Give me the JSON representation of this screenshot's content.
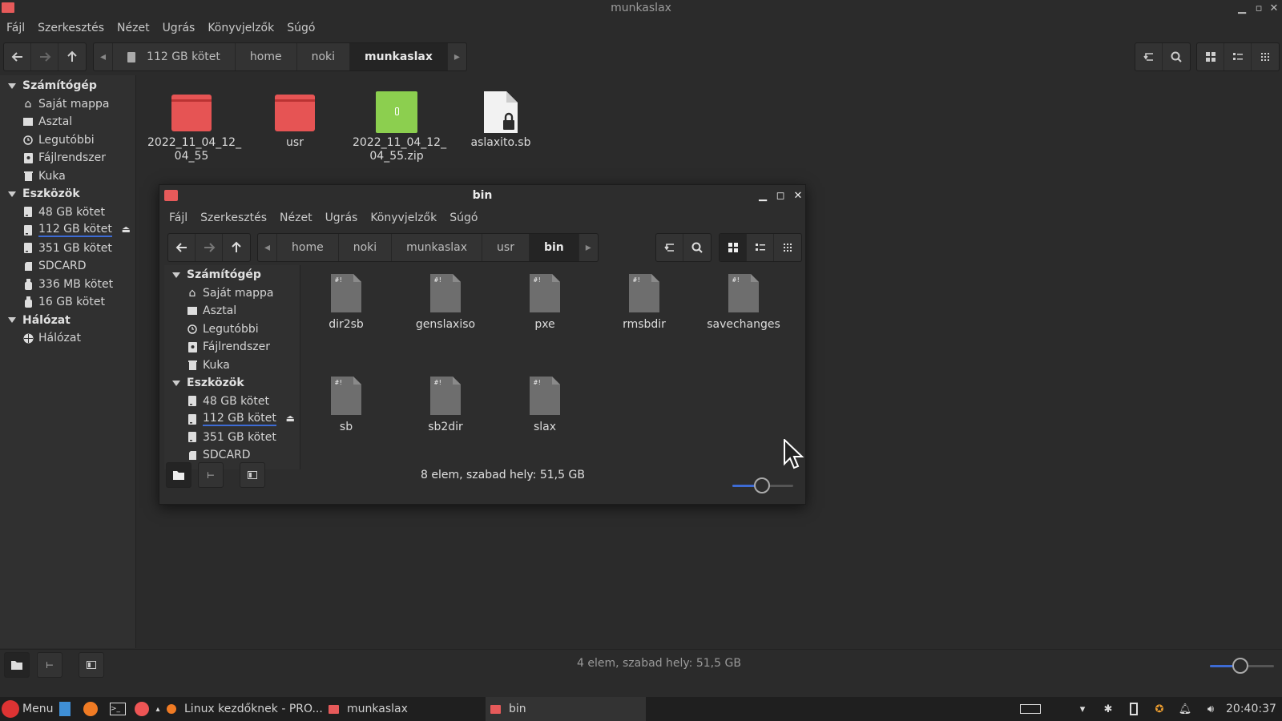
{
  "main_window": {
    "title": "munkaslax",
    "menu": [
      "Fájl",
      "Szerkesztés",
      "Nézet",
      "Ugrás",
      "Könyvjelzők",
      "Súgó"
    ],
    "breadcrumbs": [
      "112 GB kötet",
      "home",
      "noki",
      "munkaslax"
    ],
    "sidebar": {
      "sections": [
        {
          "label": "Számítógép",
          "items": [
            {
              "label": "Saját mappa",
              "icon": "home-icon"
            },
            {
              "label": "Asztal",
              "icon": "desktop-icon"
            },
            {
              "label": "Legutóbbi",
              "icon": "clock-icon"
            },
            {
              "label": "Fájlrendszer",
              "icon": "drive-icon"
            },
            {
              "label": "Kuka",
              "icon": "trash-icon"
            }
          ]
        },
        {
          "label": "Eszközök",
          "items": [
            {
              "label": "48 GB kötet",
              "icon": "drive-icon"
            },
            {
              "label": "112 GB kötet",
              "icon": "drive-icon"
            },
            {
              "label": "351 GB kötet",
              "icon": "drive-icon"
            },
            {
              "label": "SDCARD",
              "icon": "sdcard-icon"
            },
            {
              "label": "336 MB kötet",
              "icon": "usb-icon"
            },
            {
              "label": "16 GB kötet",
              "icon": "usb-icon"
            }
          ]
        },
        {
          "label": "Hálózat",
          "items": [
            {
              "label": "Hálózat",
              "icon": "network-icon"
            }
          ]
        }
      ]
    },
    "files": [
      {
        "name": "2022_11_04_12_\n04_55",
        "type": "folder"
      },
      {
        "name": "usr",
        "type": "folder"
      },
      {
        "name": "2022_11_04_12_\n04_55.zip",
        "type": "zip"
      },
      {
        "name": "aslaxito.sb",
        "type": "locked-file"
      }
    ],
    "status": "4 elem, szabad hely: 51,5 GB"
  },
  "bin_window": {
    "title": "bin",
    "menu": [
      "Fájl",
      "Szerkesztés",
      "Nézet",
      "Ugrás",
      "Könyvjelzők",
      "Súgó"
    ],
    "breadcrumbs": [
      "home",
      "noki",
      "munkaslax",
      "usr",
      "bin"
    ],
    "sidebar": {
      "sections": [
        {
          "label": "Számítógép",
          "items": [
            {
              "label": "Saját mappa",
              "icon": "home-icon"
            },
            {
              "label": "Asztal",
              "icon": "desktop-icon"
            },
            {
              "label": "Legutóbbi",
              "icon": "clock-icon"
            },
            {
              "label": "Fájlrendszer",
              "icon": "drive-icon"
            },
            {
              "label": "Kuka",
              "icon": "trash-icon"
            }
          ]
        },
        {
          "label": "Eszközök",
          "items": [
            {
              "label": "48 GB kötet",
              "icon": "drive-icon"
            },
            {
              "label": "112 GB kötet",
              "icon": "drive-icon"
            },
            {
              "label": "351 GB kötet",
              "icon": "drive-icon"
            },
            {
              "label": "SDCARD",
              "icon": "sdcard-icon"
            }
          ]
        }
      ]
    },
    "files": [
      "dir2sb",
      "genslaxiso",
      "pxe",
      "rmsbdir",
      "savechanges",
      "sb",
      "sb2dir",
      "slax"
    ],
    "status": "8 elem, szabad hely: 51,5 GB"
  },
  "taskbar": {
    "menu_label": "Menu",
    "tasks": [
      "Linux kezdőknek - PRO...",
      "munkaslax",
      "bin"
    ],
    "clock": "20:40:37"
  },
  "colors": {
    "accent": "#3d6bd4",
    "folder": "#e65454",
    "zip": "#8ccf4f",
    "bg": "#2b2b2b"
  }
}
